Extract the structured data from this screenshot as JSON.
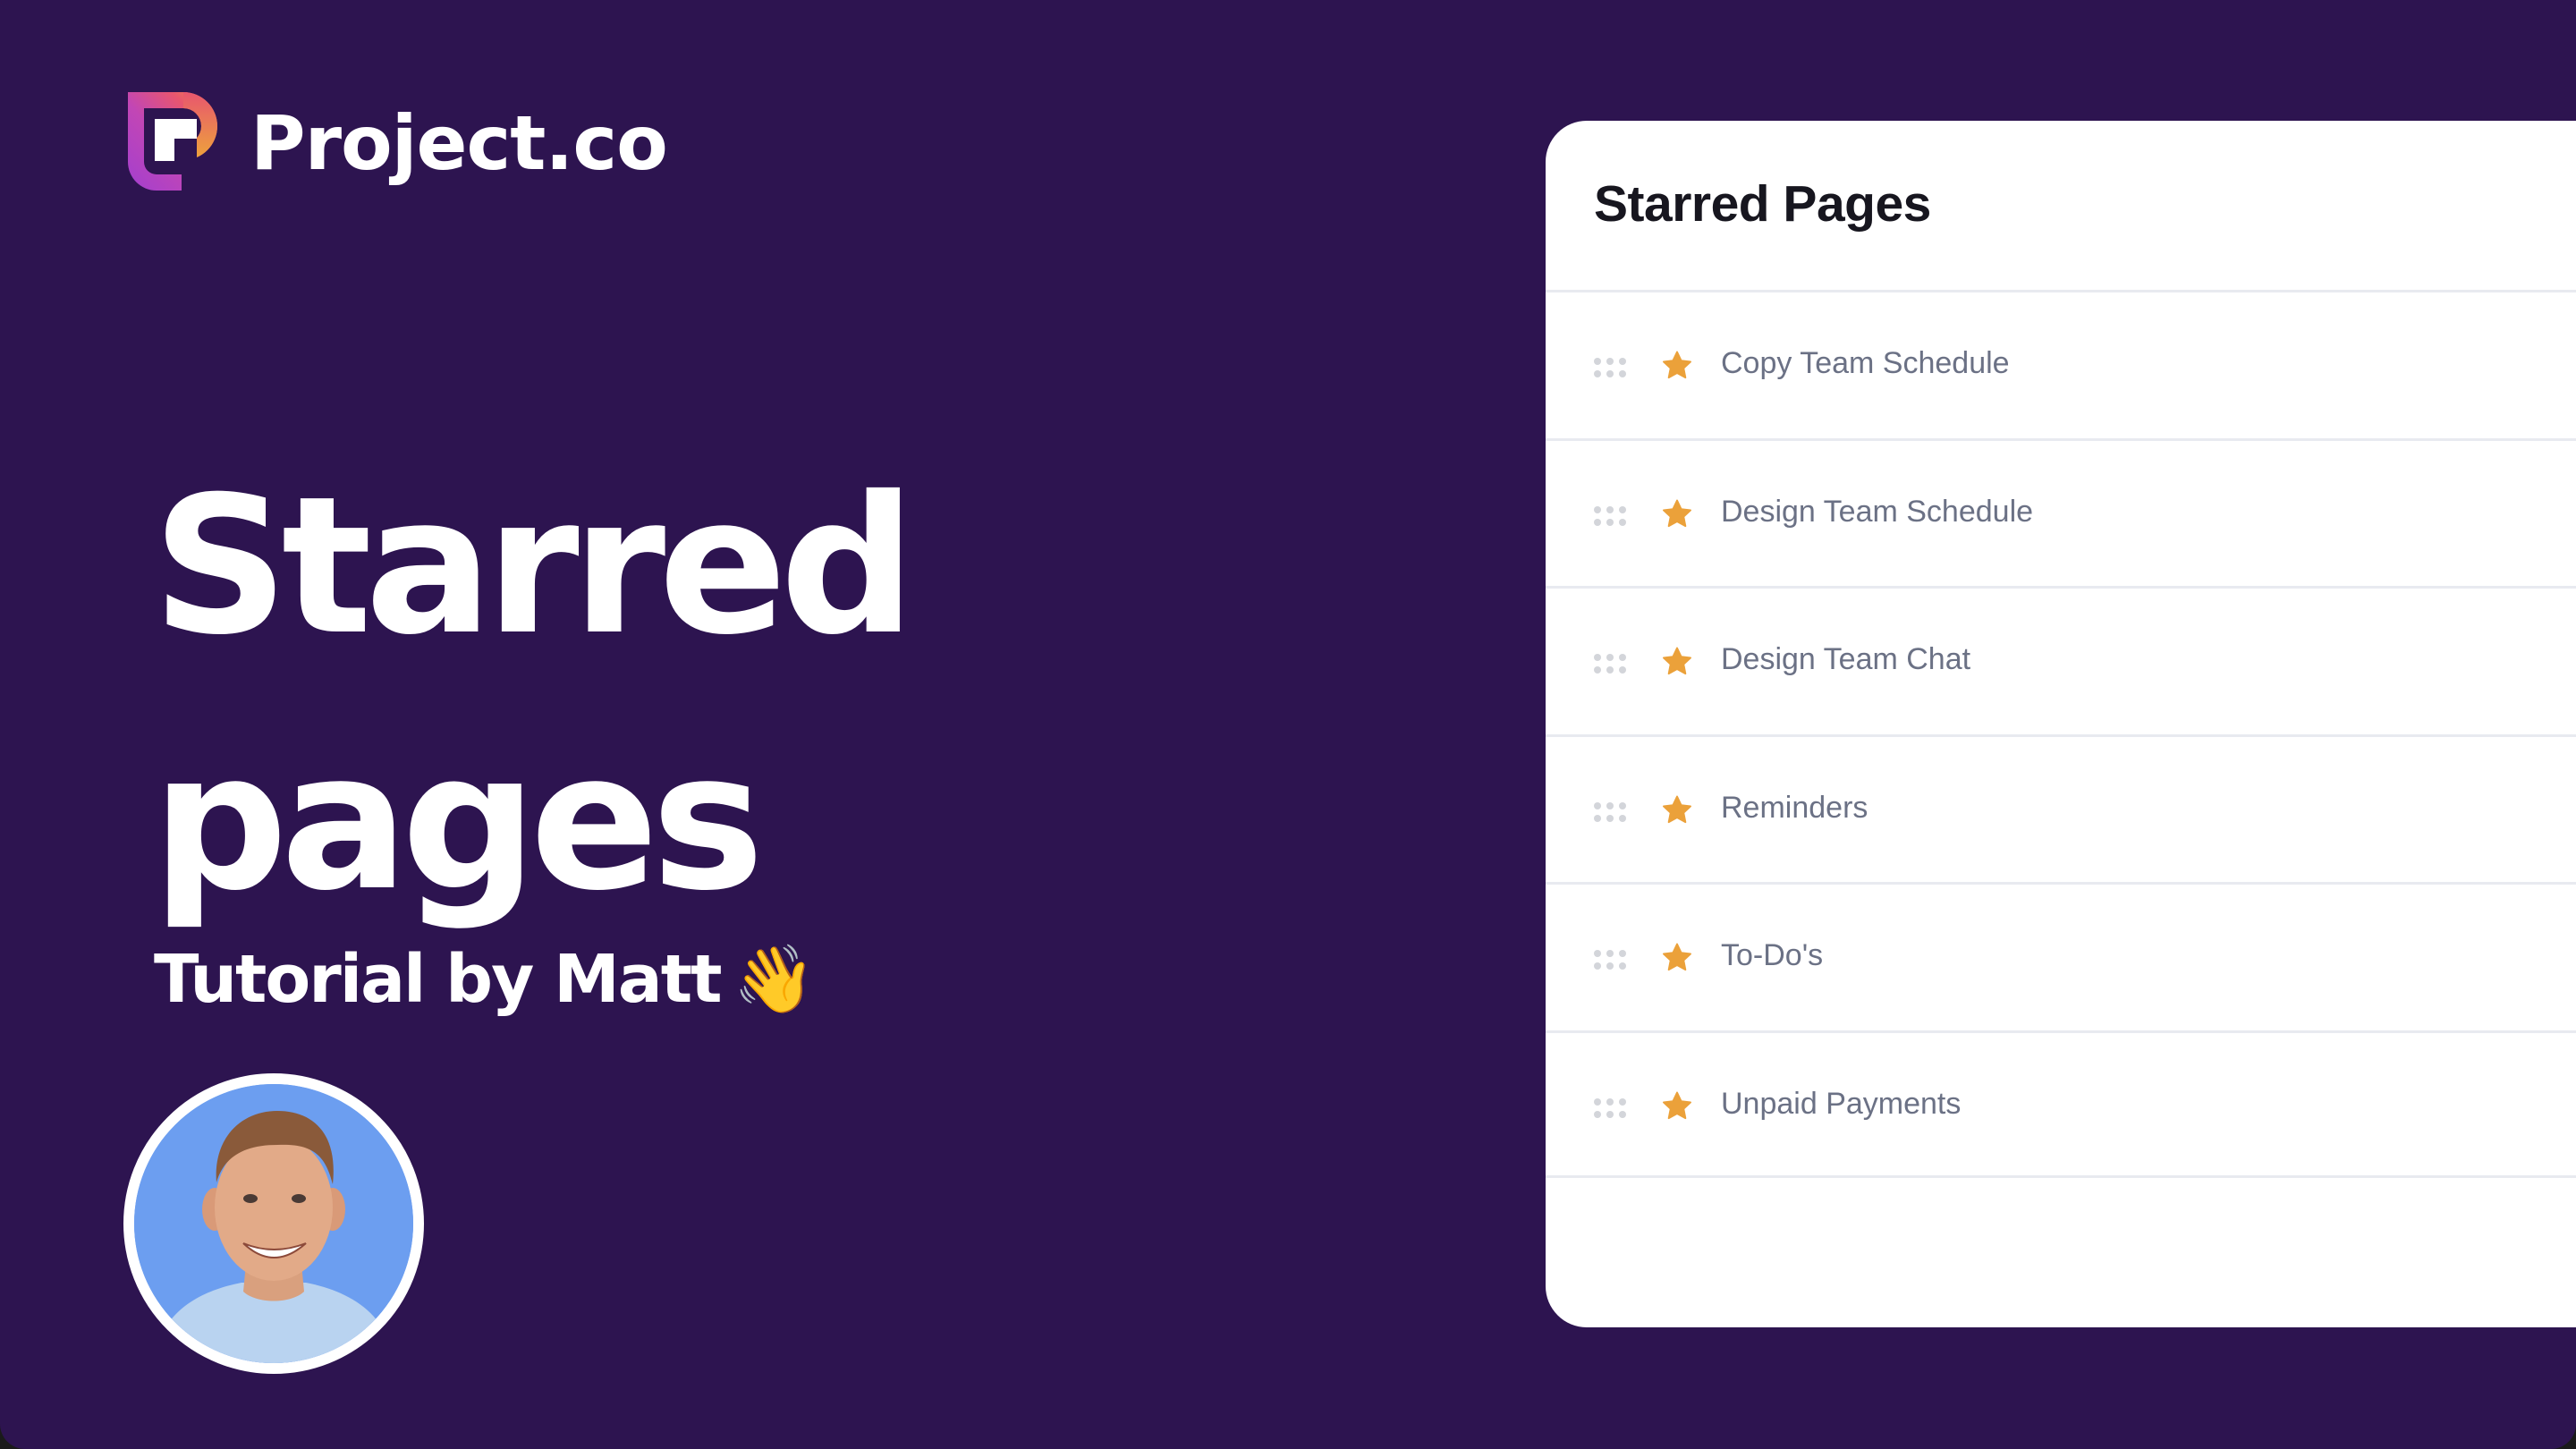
{
  "brand": {
    "name": "Project.co",
    "logo_icon": "project-co-logo-icon",
    "colors": {
      "background": "#2D1450",
      "logo_gradient": [
        "#A33FCF",
        "#E8566E",
        "#EDA53A"
      ],
      "star": "#EBA13A",
      "card_text": "#6B7185",
      "avatar_bg": "#6C9EF0"
    }
  },
  "hero": {
    "title_line1": "Starred",
    "title_line2": "pages",
    "subtitle": "Tutorial by Matt",
    "subtitle_emoji": "👋"
  },
  "presenter": {
    "avatar_icon": "presenter-photo"
  },
  "card": {
    "title": "Starred Pages",
    "items": [
      {
        "label": "Copy Team Schedule",
        "starred": true
      },
      {
        "label": "Design Team Schedule",
        "starred": true
      },
      {
        "label": "Design Team Chat",
        "starred": true
      },
      {
        "label": "Reminders",
        "starred": true
      },
      {
        "label": "To-Do's",
        "starred": true
      },
      {
        "label": "Unpaid Payments",
        "starred": true
      }
    ]
  }
}
